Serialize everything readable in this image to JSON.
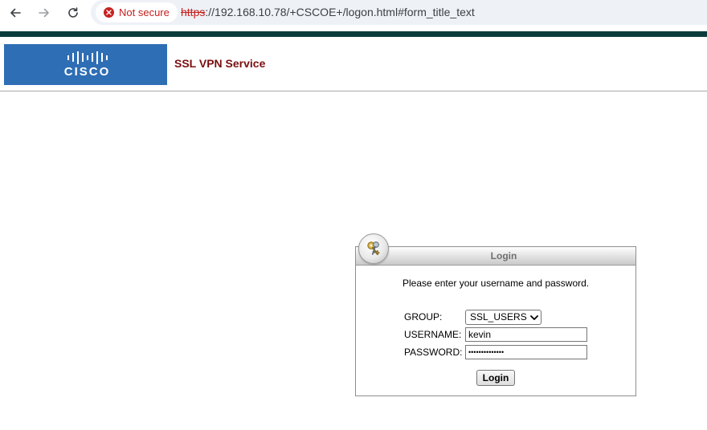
{
  "browser": {
    "security_label": "Not secure",
    "url_scheme": "https",
    "url_rest": "://192.168.10.78/+CSCOE+/logon.html#form_title_text"
  },
  "header": {
    "logo_text": "CISCO",
    "service_title": "SSL VPN Service"
  },
  "login": {
    "title": "Login",
    "prompt": "Please enter your username and password.",
    "group_label": "GROUP:",
    "group_value": "SSL_USERS",
    "username_label": "USERNAME:",
    "username_value": "kevin",
    "password_label": "PASSWORD:",
    "password_masked": "••••••••••••••",
    "submit_label": "Login"
  },
  "colors": {
    "top_stripe": "#0c3b3c",
    "logo_bg": "#2e6eb5",
    "service_title": "#7a0e0e",
    "not_secure": "#c5221f"
  }
}
